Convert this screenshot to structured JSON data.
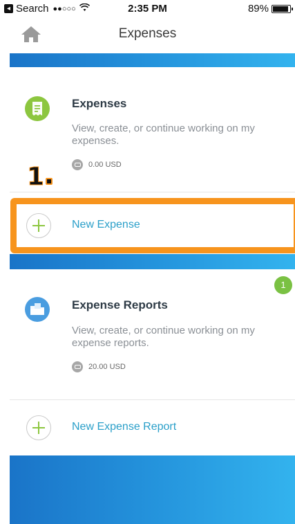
{
  "status_bar": {
    "back_app": "Search",
    "signal": "●●○○○",
    "time": "2:35 PM",
    "battery": "89%"
  },
  "nav": {
    "title": "Expenses",
    "home_icon": "home-icon"
  },
  "expenses_card": {
    "title": "Expenses",
    "description": "View, create, or continue working on my expenses.",
    "amount": "0.00 USD",
    "icon": "receipt-icon",
    "icon_color": "#8cc63f"
  },
  "annotation": {
    "step_label": "1",
    "highlight_color": "#f7941d"
  },
  "new_expense": {
    "label": "New Expense"
  },
  "reports_card": {
    "title": "Expense Reports",
    "description": "View, create, or continue working on my expense reports.",
    "amount": "20.00 USD",
    "icon": "folder-icon",
    "icon_color": "#4a9de0",
    "badge_count": "1"
  },
  "new_report": {
    "label": "New Expense Report"
  },
  "colors": {
    "accent_blue": "#2a9fc9",
    "band_gradient_start": "#1a74c8",
    "band_gradient_end": "#33b3ee",
    "badge_green": "#7ac143"
  }
}
